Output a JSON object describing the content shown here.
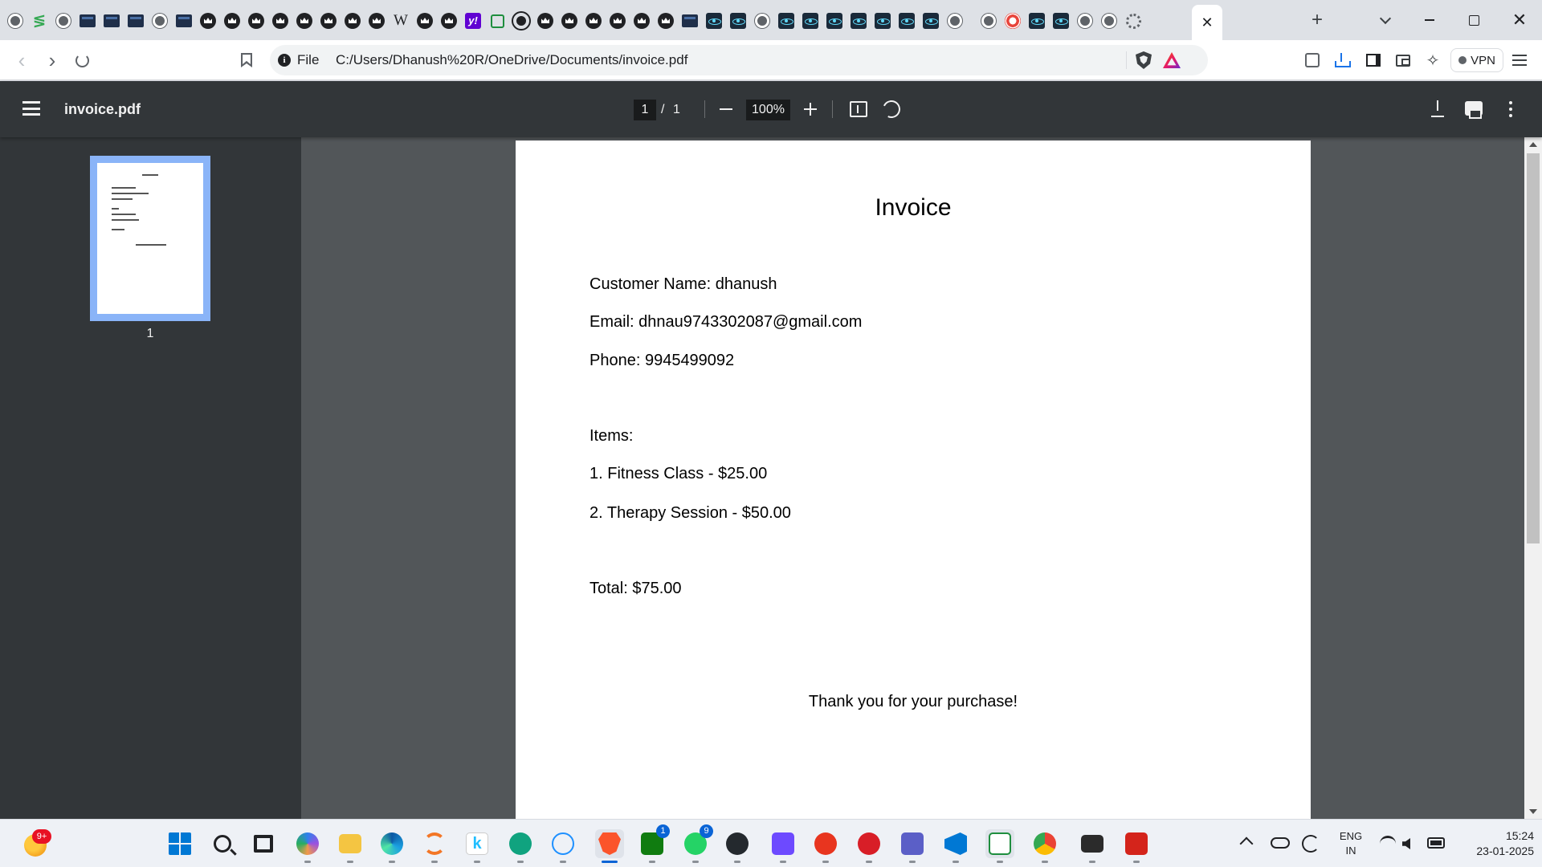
{
  "browser": {
    "tabs": {
      "favicons": [
        "globe-icon",
        "swatch-icon",
        "globe-icon",
        "terminal-icon",
        "terminal-icon",
        "terminal-icon",
        "globe-icon",
        "terminal-icon",
        "crown-icon",
        "crown-icon",
        "crown-icon",
        "crown-icon",
        "crown-icon",
        "crown-icon",
        "crown-icon",
        "crown-icon",
        "wikipedia-icon",
        "crown-icon",
        "crown-icon",
        "yahoo-icon",
        "sheet-icon",
        "github-icon",
        "crown-icon",
        "crown-icon",
        "crown-icon",
        "crown-icon",
        "crown-icon",
        "crown-icon",
        "terminal-icon",
        "react-icon",
        "react-icon",
        "globe-icon",
        "react-icon",
        "react-icon",
        "react-icon",
        "react-icon",
        "react-icon",
        "react-icon",
        "react-icon",
        "globe-icon",
        "globe-icon",
        "target-icon",
        "react-icon",
        "react-icon",
        "globe-icon",
        "globe-icon",
        "gear-icon"
      ],
      "active_tab_close": "✕",
      "new_tab": "+"
    },
    "window_controls": {
      "close": "✕"
    },
    "toolbar": {
      "back": "‹",
      "forward": "›",
      "scheme_label": "File",
      "info_glyph": "i",
      "url": "C:/Users/Dhanush%20R/OneDrive/Documents/invoice.pdf",
      "leo_glyph": "✧",
      "vpn_label": "VPN"
    },
    "accent": "#8ab4f8"
  },
  "pdf_viewer": {
    "title": "invoice.pdf",
    "page_current": "1",
    "page_separator": "/",
    "page_total": "1",
    "zoom": "100%",
    "thumbnail_label": "1",
    "toolbar_bg": "#323639",
    "canvas_bg": "#525659"
  },
  "document": {
    "title": "Invoice",
    "customer_line": "Customer Name: dhanush",
    "email_line": "Email: dhnau9743302087@gmail.com",
    "phone_line": "Phone: 9945499092",
    "items_heading": "Items:",
    "items": [
      "1. Fitness Class - $25.00",
      "2. Therapy Session - $50.00"
    ],
    "total_line": "Total: $75.00",
    "thanks_line": "Thank you for your purchase!"
  },
  "taskbar": {
    "weather_badge": "9+",
    "apps": [
      {
        "name": "start-button",
        "icon": "windows-icon"
      },
      {
        "name": "search-button",
        "icon": "search-icon"
      },
      {
        "name": "task-view-button",
        "icon": "task-view-icon"
      },
      {
        "name": "copilot-app",
        "icon": "copilot-icon"
      },
      {
        "name": "file-explorer-app",
        "icon": "folder-icon"
      },
      {
        "name": "edge-app",
        "icon": "edge-icon"
      },
      {
        "name": "jupyter-app",
        "icon": "jupyter-icon"
      },
      {
        "name": "kaggle-app",
        "icon": "kaggle-icon"
      },
      {
        "name": "chatgpt-app",
        "icon": "chatgpt-icon"
      },
      {
        "name": "react-devtools-app",
        "icon": "react-icon"
      },
      {
        "name": "brave-app",
        "icon": "brave-icon"
      },
      {
        "name": "xbox-app",
        "icon": "xbox-icon",
        "badge": "1"
      },
      {
        "name": "whatsapp-app",
        "icon": "whatsapp-icon",
        "badge": "9"
      },
      {
        "name": "github-desktop-app",
        "icon": "github-icon"
      },
      {
        "name": "proton-app",
        "icon": "proton-icon"
      },
      {
        "name": "wps-app",
        "icon": "wps-icon"
      },
      {
        "name": "notes-app",
        "icon": "notes-icon"
      },
      {
        "name": "teams-app",
        "icon": "teams-icon"
      },
      {
        "name": "vscode-app",
        "icon": "vscode-icon"
      },
      {
        "name": "sheets-app",
        "icon": "sheets-icon"
      },
      {
        "name": "chrome-app",
        "icon": "chrome-icon"
      },
      {
        "name": "terminal-app",
        "icon": "terminal-icon"
      },
      {
        "name": "acrobat-app",
        "icon": "acrobat-icon"
      }
    ],
    "tray": {
      "lang_primary": "ENG",
      "lang_secondary": "IN",
      "time": "15:24",
      "date": "23-01-2025"
    }
  }
}
